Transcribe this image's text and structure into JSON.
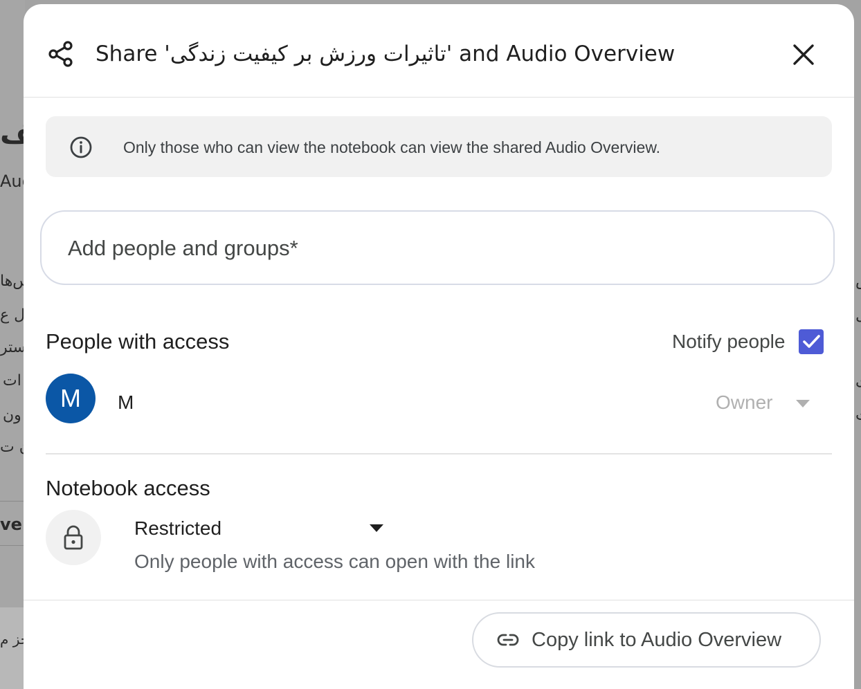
{
  "background": {
    "fragments": [
      "کیف",
      "Aug",
      "س‌ها",
      "ل ع",
      "ستر",
      "ات",
      "ون",
      "ن ت",
      "ve",
      "خز م"
    ],
    "right_fragments": [
      "س",
      "ل",
      "ی",
      "ی",
      "ت"
    ]
  },
  "dialog": {
    "title": "Share 'تاثیرات ورزش بر کیفیت زندگی' and Audio Overview",
    "info_text": "Only those who can view the notebook can view the shared Audio Overview.",
    "add_people_placeholder": "Add people and groups*",
    "people_section_title": "People with access",
    "notify_label": "Notify people",
    "notify_checked": true,
    "person": {
      "avatar_letter": "M",
      "name": "M",
      "role": "Owner"
    },
    "notebook_section_title": "Notebook access",
    "access_level": "Restricted",
    "access_description": "Only people with access can open with the link",
    "copy_link_label": "Copy link to Audio Overview"
  },
  "colors": {
    "avatar": "#0b57a6",
    "checkbox": "#4e5bd6",
    "info_bg": "#f1f1f1"
  },
  "icons": [
    "share-icon",
    "close-icon",
    "info-icon",
    "checkmark-icon",
    "dropdown-caret-icon",
    "lock-icon",
    "link-icon"
  ]
}
